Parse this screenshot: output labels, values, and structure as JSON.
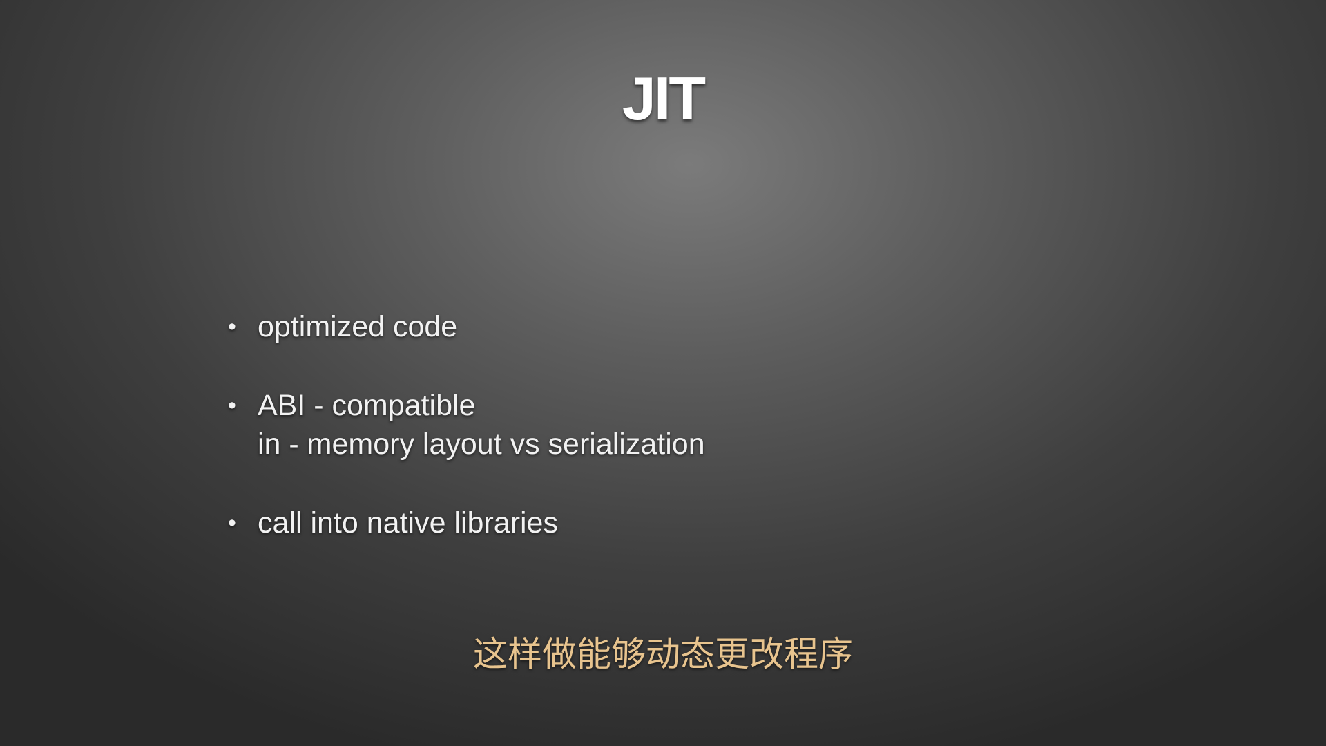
{
  "slide": {
    "title": "JIT",
    "bullets": [
      {
        "lines": [
          "optimized code"
        ]
      },
      {
        "lines": [
          "ABI - compatible",
          "in - memory layout vs serialization"
        ]
      },
      {
        "lines": [
          "call into native libraries"
        ]
      }
    ],
    "bullet_symbol": "•"
  },
  "subtitle": {
    "text": "这样做能够动态更改程序"
  },
  "colors": {
    "title": "#ffffff",
    "bullet_text": "#f2f2f2",
    "subtitle": "#e8c48e"
  }
}
